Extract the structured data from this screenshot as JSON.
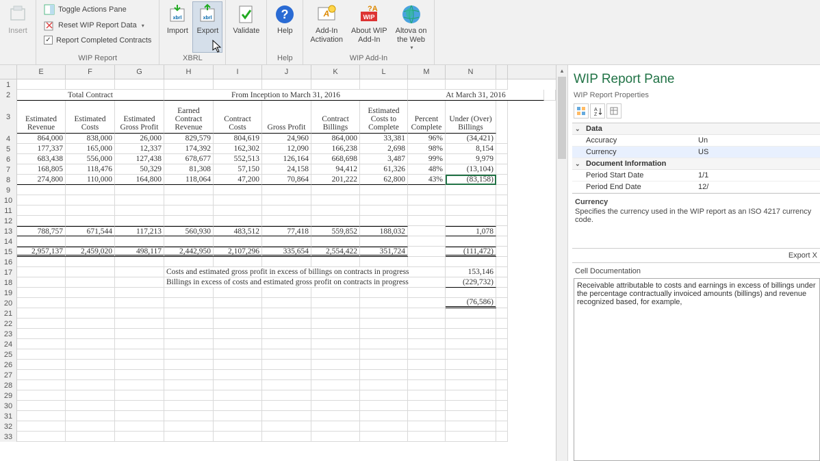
{
  "ribbon": {
    "insert": {
      "label": "Insert"
    },
    "wip": {
      "toggle": "Toggle Actions Pane",
      "reset": "Reset WIP Report Data",
      "report_completed": "Report Completed Contracts",
      "group_label": "WIP Report"
    },
    "xbrl": {
      "import": "Import",
      "export": "Export",
      "group_label": "XBRL"
    },
    "validate": {
      "label": "Validate"
    },
    "help": {
      "label": "Help",
      "group_label": "Help"
    },
    "addin": {
      "activation": "Add-In\nActivation",
      "about": "About WIP\nAdd-In",
      "altova": "Altova on\nthe Web",
      "group_label": "WIP Add-In"
    }
  },
  "sheet": {
    "columns": [
      "E",
      "F",
      "G",
      "H",
      "I",
      "J",
      "K",
      "L",
      "M",
      "N",
      ""
    ],
    "group_headers": {
      "total_contract": "Total Contract",
      "inception": "From Inception to March 31, 2016",
      "at_date": "At March 31, 2016"
    },
    "col_headers": {
      "E": "Estimated\nRevenue",
      "F": "Estimated\nCosts",
      "G": "Estimated\nGross Profit",
      "H": "Earned\nContract\nRevenue",
      "I": "Contract\nCosts",
      "J": "Gross Profit",
      "K": "Contract\nBillings",
      "L": "Estimated\nCosts to\nComplete",
      "M": "Percent\nComplete",
      "N": "Under (Over)\nBillings"
    },
    "data_rows": [
      {
        "r": 4,
        "E": "864,000",
        "F": "838,000",
        "G": "26,000",
        "H": "829,579",
        "I": "804,619",
        "J": "24,960",
        "K": "864,000",
        "L": "33,381",
        "M": "96%",
        "N": "(34,421)"
      },
      {
        "r": 5,
        "E": "177,337",
        "F": "165,000",
        "G": "12,337",
        "H": "174,392",
        "I": "162,302",
        "J": "12,090",
        "K": "166,238",
        "L": "2,698",
        "M": "98%",
        "N": "8,154"
      },
      {
        "r": 6,
        "E": "683,438",
        "F": "556,000",
        "G": "127,438",
        "H": "678,677",
        "I": "552,513",
        "J": "126,164",
        "K": "668,698",
        "L": "3,487",
        "M": "99%",
        "N": "9,979"
      },
      {
        "r": 7,
        "E": "168,805",
        "F": "118,476",
        "G": "50,329",
        "H": "81,308",
        "I": "57,150",
        "J": "24,158",
        "K": "94,412",
        "L": "61,326",
        "M": "48%",
        "N": "(13,104)"
      },
      {
        "r": 8,
        "E": "274,800",
        "F": "110,000",
        "G": "164,800",
        "H": "118,064",
        "I": "47,200",
        "J": "70,864",
        "K": "201,222",
        "L": "62,800",
        "M": "43%",
        "N": "(83,158)"
      }
    ],
    "subtotal": {
      "r": 13,
      "E": "788,757",
      "F": "671,544",
      "G": "117,213",
      "H": "560,930",
      "I": "483,512",
      "J": "77,418",
      "K": "559,852",
      "L": "188,032",
      "M": "",
      "N": "1,078"
    },
    "total": {
      "r": 15,
      "E": "2,957,137",
      "F": "2,459,020",
      "G": "498,117",
      "H": "2,442,950",
      "I": "2,107,296",
      "J": "335,654",
      "K": "2,554,422",
      "L": "351,724",
      "M": "",
      "N": "(111,472)"
    },
    "note1": {
      "r": 17,
      "text": "Costs and estimated gross profit in excess of billings on contracts in progress",
      "N": "153,146"
    },
    "note2": {
      "r": 18,
      "text": "Billings in excess of costs and estimated gross profit on contracts in progress",
      "N": "(229,732)"
    },
    "final": {
      "r": 20,
      "N": "(76,586)"
    }
  },
  "pane": {
    "title": "WIP Report Pane",
    "subtitle": "WIP Report Properties",
    "cats": {
      "data": "Data",
      "doc": "Document Information"
    },
    "props": {
      "accuracy": {
        "k": "Accuracy",
        "v": "Un"
      },
      "currency": {
        "k": "Currency",
        "v": "US"
      },
      "period_start": {
        "k": "Period Start Date",
        "v": "1/1"
      },
      "period_end": {
        "k": "Period End Date",
        "v": "12/"
      }
    },
    "desc": {
      "title": "Currency",
      "body": "Specifies the currency used in the WIP report as an ISO 4217 currency code."
    },
    "export": "Export X",
    "celldoc_h": "Cell Documentation",
    "celldoc_body": "Receivable attributable to costs and earnings in excess of billings under the percentage contractually invoiced amounts (billings) and revenue recognized based, for example, "
  }
}
